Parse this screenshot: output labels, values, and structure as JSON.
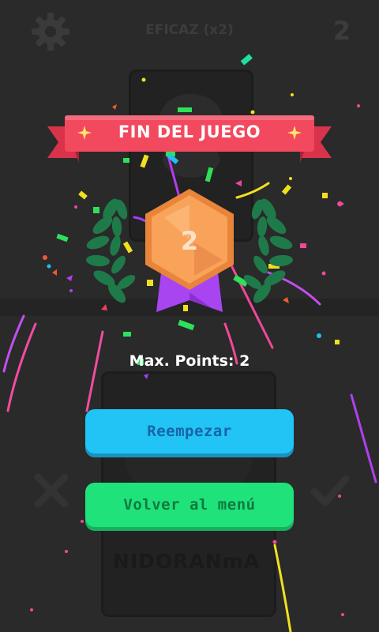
{
  "header": {
    "mode_label": "EFICAZ (x2)",
    "score": "2"
  },
  "card": {
    "bottom_name": "NIDORANmA"
  },
  "game_over": {
    "title": "FIN DEL JUEGO",
    "medal_value": "2",
    "max_points_label": "Max. Points: 2",
    "restart_label": "Reempezar",
    "menu_label": "Volver al menú"
  },
  "colors": {
    "banner": "#f2495f",
    "medal": "#f9a35a",
    "ribbon": "#a845f0",
    "laurel": "#1f7a4a",
    "restart_button": "#22c4f5",
    "menu_button": "#1fe27a"
  },
  "icons": [
    "gear-icon",
    "close-icon",
    "check-icon",
    "sparkle-icon",
    "laurel-icon",
    "medal-icon"
  ]
}
